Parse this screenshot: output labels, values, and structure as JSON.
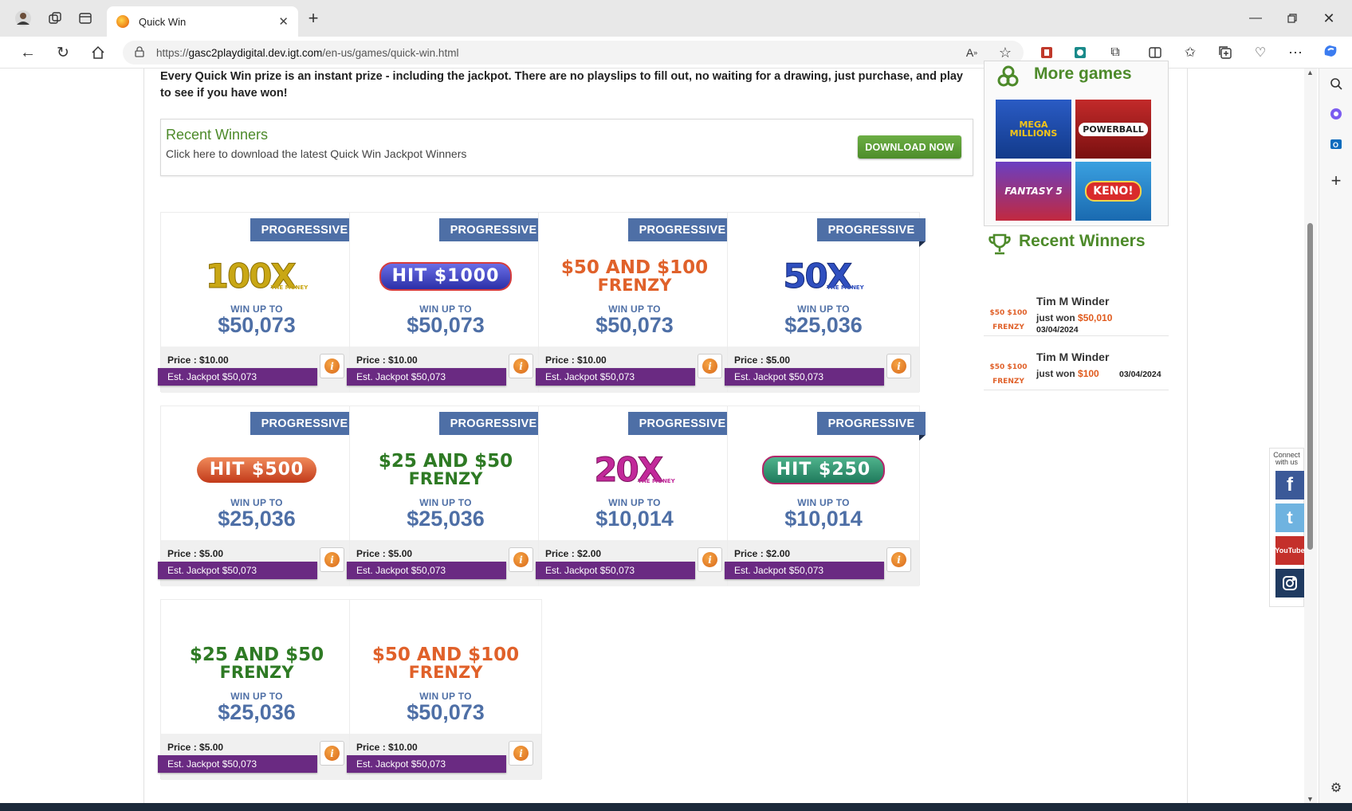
{
  "browser": {
    "tab_title": "Quick Win",
    "url_prefix": "https://",
    "url_host": "gasc2playdigital.dev.igt.com",
    "url_path": "/en-us/games/quick-win.html"
  },
  "intro": {
    "text": "Every Quick Win prize is an instant prize - including the jackpot. There are no playslips to fill out, no waiting for a drawing, just purchase, and play to see if you have won!"
  },
  "recent_box": {
    "title": "Recent Winners",
    "subtitle": "Click here to download the latest Quick Win Jackpot Winners",
    "button": "DOWNLOAD NOW"
  },
  "games": [
    {
      "ribbon": "PROGRESSIVE",
      "logo": "100X",
      "logo_sub": "THE MONEY",
      "win_label": "WIN UP TO",
      "prize": "$50,073",
      "price": "Price : $10.00",
      "jackpot": "Est. Jackpot $50,073"
    },
    {
      "ribbon": "PROGRESSIVE",
      "logo": "HIT $1000",
      "logo_sub": "",
      "win_label": "WIN UP TO",
      "prize": "$50,073",
      "price": "Price : $10.00",
      "jackpot": "Est. Jackpot $50,073"
    },
    {
      "ribbon": "PROGRESSIVE",
      "logo": "$50 AND $100",
      "logo_sub": "FRENZY",
      "win_label": "WIN UP TO",
      "prize": "$50,073",
      "price": "Price : $10.00",
      "jackpot": "Est. Jackpot $50,073"
    },
    {
      "ribbon": "PROGRESSIVE",
      "logo": "50X",
      "logo_sub": "THE MONEY",
      "win_label": "WIN UP TO",
      "prize": "$25,036",
      "price": "Price : $5.00",
      "jackpot": "Est. Jackpot $50,073"
    },
    {
      "ribbon": "PROGRESSIVE",
      "logo": "HIT $500",
      "logo_sub": "",
      "win_label": "WIN UP TO",
      "prize": "$25,036",
      "price": "Price : $5.00",
      "jackpot": "Est. Jackpot $50,073"
    },
    {
      "ribbon": "PROGRESSIVE",
      "logo": "$25 AND $50",
      "logo_sub": "FRENZY",
      "win_label": "WIN UP TO",
      "prize": "$25,036",
      "price": "Price : $5.00",
      "jackpot": "Est. Jackpot $50,073"
    },
    {
      "ribbon": "PROGRESSIVE",
      "logo": "20X",
      "logo_sub": "THE MONEY",
      "win_label": "WIN UP TO",
      "prize": "$10,014",
      "price": "Price : $2.00",
      "jackpot": "Est. Jackpot $50,073"
    },
    {
      "ribbon": "PROGRESSIVE",
      "logo": "HIT $250",
      "logo_sub": "",
      "win_label": "WIN UP TO",
      "prize": "$10,014",
      "price": "Price : $2.00",
      "jackpot": "Est. Jackpot $50,073"
    },
    {
      "ribbon": "",
      "logo": "$25 AND $50",
      "logo_sub": "FRENZY",
      "win_label": "WIN UP TO",
      "prize": "$25,036",
      "price": "Price : $5.00",
      "jackpot": "Est. Jackpot $50,073"
    },
    {
      "ribbon": "",
      "logo": "$50 AND $100",
      "logo_sub": "FRENZY",
      "win_label": "WIN UP TO",
      "prize": "$50,073",
      "price": "Price : $10.00",
      "jackpot": "Est. Jackpot $50,073"
    }
  ],
  "more_games": {
    "title": "More games",
    "items": [
      "MEGA MILLIONS",
      "POWERBALL",
      "FANTASY 5",
      "KENO!"
    ]
  },
  "recent_winners": {
    "title": "Recent Winners",
    "items": [
      {
        "name": "Tim M Winder",
        "won_prefix": "just won",
        "amount": "$50,010",
        "date": "03/04/2024"
      },
      {
        "name": "Tim M Winder",
        "won_prefix": "just won",
        "amount": "$100",
        "date": "03/04/2024"
      }
    ]
  },
  "connect": {
    "label_line1": "Connect",
    "label_line2": "with us",
    "youtube": "YouTube"
  }
}
